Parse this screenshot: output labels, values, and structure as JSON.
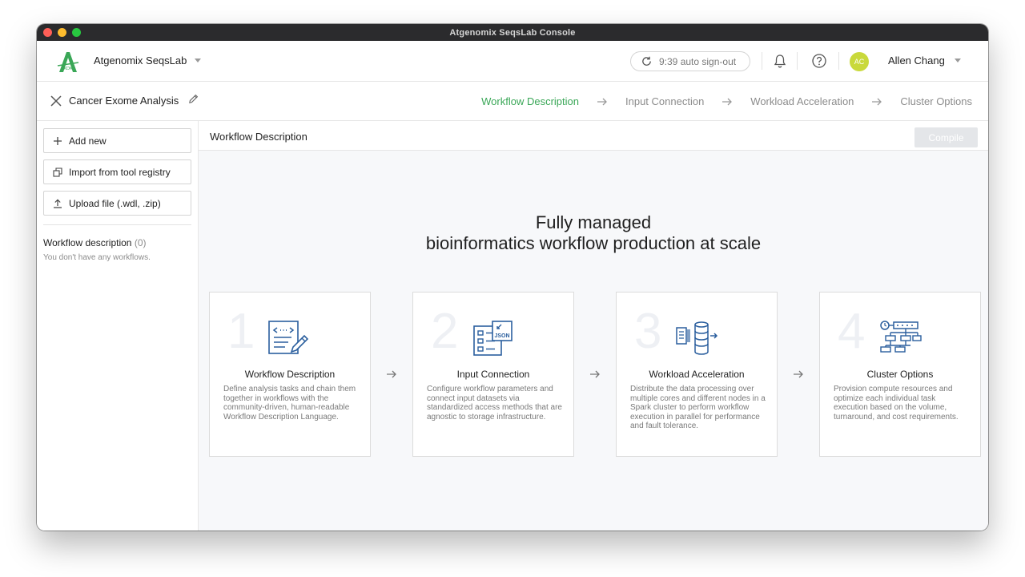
{
  "window": {
    "title": "Atgenomix SeqsLab Console"
  },
  "topbar": {
    "app_name": "Atgenomix SeqsLab",
    "signout_text": "9:39 auto sign-out",
    "avatar_initials": "AC",
    "user_name": "Allen Chang",
    "accent": "#3aa757"
  },
  "subbar": {
    "project_name": "Cancer Exome Analysis",
    "steps": [
      {
        "label": "Workflow Description",
        "active": true
      },
      {
        "label": "Input Connection",
        "active": false
      },
      {
        "label": "Workload Acceleration",
        "active": false
      },
      {
        "label": "Cluster Options",
        "active": false
      }
    ]
  },
  "sidebar": {
    "buttons": [
      {
        "label": "Add new",
        "icon": "plus-icon"
      },
      {
        "label": "Import from tool registry",
        "icon": "copy-icon"
      },
      {
        "label": "Upload file (.wdl, .zip)",
        "icon": "upload-icon"
      }
    ],
    "workflow_heading": "Workflow description",
    "workflow_count": "(0)",
    "empty_text": "You don't have any workflows."
  },
  "content": {
    "title": "Workflow Description",
    "compile_label": "Compile",
    "hero_line1": "Fully managed",
    "hero_line2": "bioinformatics workflow production at scale",
    "cards": [
      {
        "num": "1",
        "title": "Workflow Description",
        "desc": "Define analysis tasks and chain them together in workflows with the community-driven, human-readable Workflow Description Language.",
        "icon": "code-document-icon"
      },
      {
        "num": "2",
        "title": "Input Connection",
        "desc": "Configure workflow parameters and connect input datasets via standardized access methods that are agnostic to storage infrastructure.",
        "icon": "json-form-icon",
        "icon_text": "JSON"
      },
      {
        "num": "3",
        "title": "Workload Acceleration",
        "desc": "Distribute the data processing over multiple cores and different nodes in a Spark cluster to perform workflow execution in parallel for performance and fault tolerance.",
        "icon": "database-process-icon"
      },
      {
        "num": "4",
        "title": "Cluster Options",
        "desc": "Provision compute resources and optimize each individual task execution based on the volume, turnaround, and cost requirements.",
        "icon": "cluster-tree-icon"
      }
    ]
  }
}
